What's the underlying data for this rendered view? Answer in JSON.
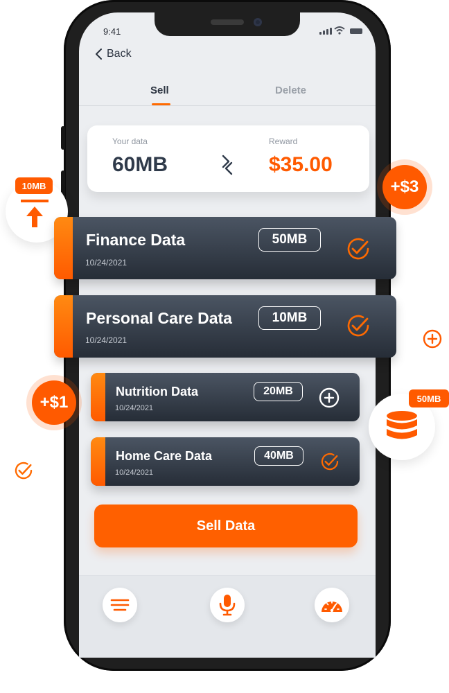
{
  "status": {
    "time": "9:41"
  },
  "nav": {
    "back_label": "Back"
  },
  "tabs": [
    {
      "label": "Sell"
    },
    {
      "label": "Delete"
    }
  ],
  "summary": {
    "data_label": "Your data",
    "data_value": "60MB",
    "reward_label": "Reward",
    "reward_value": "$35.00"
  },
  "items": [
    {
      "title": "Finance Data",
      "date": "10/24/2021",
      "size": "50MB",
      "state": "check-circle-icon"
    },
    {
      "title": "Personal Care Data",
      "date": "10/24/2021",
      "size": "10MB",
      "state": "check-circle-icon"
    },
    {
      "title": "Nutrition Data",
      "date": "10/24/2021",
      "size": "20MB",
      "state": "plus-circle-icon"
    },
    {
      "title": "Home Care Data",
      "date": "10/24/2021",
      "size": "40MB",
      "state": "check-circle-icon"
    }
  ],
  "sell_button": {
    "label": "Sell Data"
  },
  "bottom_nav": [
    {
      "icon": "menu-icon"
    },
    {
      "icon": "microphone-icon"
    },
    {
      "icon": "speedometer-icon"
    }
  ],
  "floating": {
    "upload_badge": "10MB",
    "reward_plus3": "+$3",
    "reward_plus1": "+$1",
    "db_badge": "50MB"
  },
  "colors": {
    "accent": "#ff5a00",
    "card_dark": "#2f3640",
    "background": "#eceef1"
  }
}
